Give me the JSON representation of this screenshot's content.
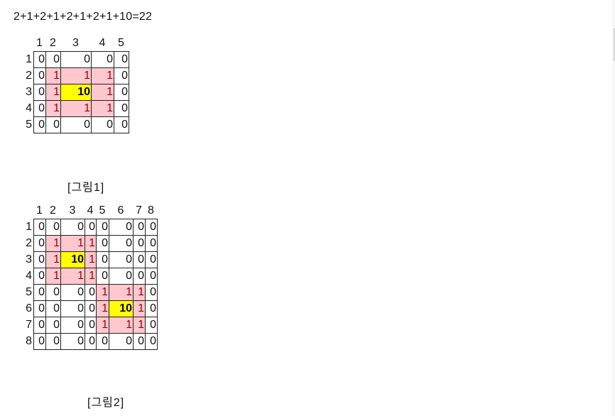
{
  "equation": "2+1+2+1+2+1+2+1+10=22",
  "colors": {
    "highlight": "#ffc7ce",
    "highlight_text": "#9c0006",
    "center": "#ffff00"
  },
  "figures": [
    {
      "caption": "[그림1]",
      "col_labels": [
        "1",
        "2",
        "3",
        "4",
        "5"
      ],
      "row_labels": [
        "1",
        "2",
        "3",
        "4",
        "5"
      ],
      "cells": [
        [
          {
            "v": "0"
          },
          {
            "v": "0"
          },
          {
            "v": "0"
          },
          {
            "v": "0"
          },
          {
            "v": "0"
          }
        ],
        [
          {
            "v": "0"
          },
          {
            "v": "1",
            "s": "pink"
          },
          {
            "v": "1",
            "s": "pink"
          },
          {
            "v": "1",
            "s": "pink"
          },
          {
            "v": "0"
          }
        ],
        [
          {
            "v": "0"
          },
          {
            "v": "1",
            "s": "pink"
          },
          {
            "v": "10",
            "s": "yellow"
          },
          {
            "v": "1",
            "s": "pink"
          },
          {
            "v": "0"
          }
        ],
        [
          {
            "v": "0"
          },
          {
            "v": "1",
            "s": "pink"
          },
          {
            "v": "1",
            "s": "pink"
          },
          {
            "v": "1",
            "s": "pink"
          },
          {
            "v": "0"
          }
        ],
        [
          {
            "v": "0"
          },
          {
            "v": "0"
          },
          {
            "v": "0"
          },
          {
            "v": "0"
          },
          {
            "v": "0"
          }
        ]
      ]
    },
    {
      "caption": "[그림2]",
      "col_labels": [
        "1",
        "2",
        "3",
        "4",
        "5",
        "6",
        "7",
        "8"
      ],
      "row_labels": [
        "1",
        "2",
        "3",
        "4",
        "5",
        "6",
        "7",
        "8"
      ],
      "cells": [
        [
          {
            "v": "0"
          },
          {
            "v": "0"
          },
          {
            "v": "0"
          },
          {
            "v": "0"
          },
          {
            "v": "0"
          },
          {
            "v": "0"
          },
          {
            "v": "0"
          },
          {
            "v": "0"
          }
        ],
        [
          {
            "v": "0"
          },
          {
            "v": "1",
            "s": "pink"
          },
          {
            "v": "1",
            "s": "pink"
          },
          {
            "v": "1",
            "s": "pink"
          },
          {
            "v": "0"
          },
          {
            "v": "0"
          },
          {
            "v": "0"
          },
          {
            "v": "0"
          }
        ],
        [
          {
            "v": "0"
          },
          {
            "v": "1",
            "s": "pink"
          },
          {
            "v": "10",
            "s": "yellow"
          },
          {
            "v": "1",
            "s": "pink"
          },
          {
            "v": "0"
          },
          {
            "v": "0"
          },
          {
            "v": "0"
          },
          {
            "v": "0"
          }
        ],
        [
          {
            "v": "0"
          },
          {
            "v": "1",
            "s": "pink"
          },
          {
            "v": "1",
            "s": "pink"
          },
          {
            "v": "1",
            "s": "pink"
          },
          {
            "v": "0"
          },
          {
            "v": "0"
          },
          {
            "v": "0"
          },
          {
            "v": "0"
          }
        ],
        [
          {
            "v": "0"
          },
          {
            "v": "0"
          },
          {
            "v": "0"
          },
          {
            "v": "0"
          },
          {
            "v": "1",
            "s": "pink"
          },
          {
            "v": "1",
            "s": "pink"
          },
          {
            "v": "1",
            "s": "pink"
          },
          {
            "v": "0"
          }
        ],
        [
          {
            "v": "0"
          },
          {
            "v": "0"
          },
          {
            "v": "0"
          },
          {
            "v": "0"
          },
          {
            "v": "1",
            "s": "pink"
          },
          {
            "v": "10",
            "s": "yellow"
          },
          {
            "v": "1",
            "s": "pink"
          },
          {
            "v": "0"
          }
        ],
        [
          {
            "v": "0"
          },
          {
            "v": "0"
          },
          {
            "v": "0"
          },
          {
            "v": "0"
          },
          {
            "v": "1",
            "s": "pink"
          },
          {
            "v": "1",
            "s": "pink"
          },
          {
            "v": "1",
            "s": "pink"
          },
          {
            "v": "0"
          }
        ],
        [
          {
            "v": "0"
          },
          {
            "v": "0"
          },
          {
            "v": "0"
          },
          {
            "v": "0"
          },
          {
            "v": "0"
          },
          {
            "v": "0"
          },
          {
            "v": "0"
          },
          {
            "v": "0"
          }
        ]
      ]
    }
  ]
}
